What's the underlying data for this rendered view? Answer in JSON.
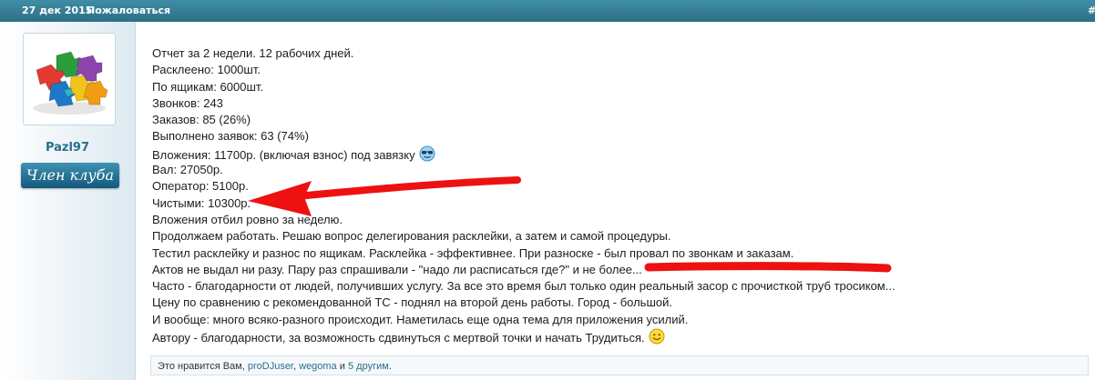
{
  "header": {
    "date": "27 дек 2015",
    "report_link": "Пожаловаться",
    "permalink": "#"
  },
  "user": {
    "username": "Pazl97",
    "badge": "Член клуба",
    "avatar_icon": "puzzle-pieces-icon"
  },
  "post": {
    "lines": [
      "Отчет за 2 недели. 12 рабочих дней.",
      "Расклеено: 1000шт.",
      "По ящикам: 6000шт.",
      "Звонков: 243",
      "Заказов: 85 (26%)",
      "Выполнено заявок: 63 (74%)",
      "Вложения: 11700р. (включая взнос) под завязку",
      "Вал: 27050р.",
      "Оператор: 5100р.",
      "Чистыми: 10300р.",
      "Вложения отбил ровно за неделю.",
      "Продолжаем работать. Решаю вопрос делегирования расклейки, а затем и самой процедуры.",
      "Тестил расклейку и разнос по ящикам. Расклейка - эффективнее. При разноске - был провал по звонкам и заказам.",
      "Актов не выдал ни разу. Пару раз спрашивали - \"надо ли расписаться где?\" и не более...",
      "Часто - благодарности от людей, получивших услугу. За все это время был только один реальный засор с прочисткой труб тросиком...",
      "Цену по сравнению с рекомендованной ТС - поднял на второй день работы. Город - большой.",
      "И вообще: много всяко-разного происходит. Наметилась еще одна тема для приложения усилий.",
      "Автору - благодарности, за возможность сдвинуться с мертвой точки и начать Трудиться."
    ],
    "emoji_cool": "cool-smiley-icon",
    "emoji_smile": "smile-icon"
  },
  "likes": {
    "prefix": "Это нравится Вам,",
    "user1": "proDJuser",
    "sep": ",",
    "user2": "wegoma",
    "and_text": "и",
    "others": "5 другим",
    "suffix": "."
  },
  "colors": {
    "header": "#2c6f86",
    "link": "#2a6f8b",
    "annotation": "#ee1111"
  }
}
